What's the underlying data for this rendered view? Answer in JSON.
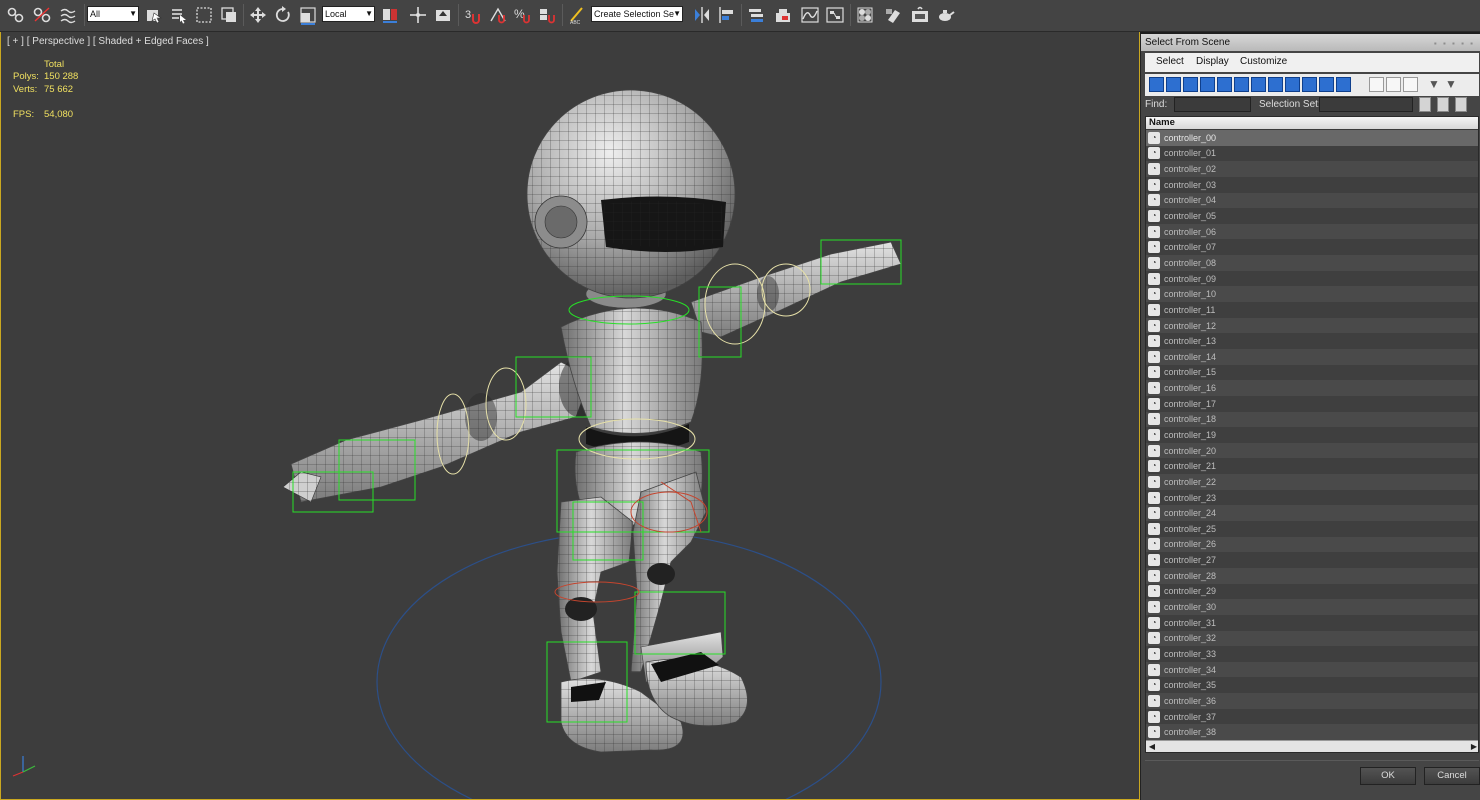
{
  "toolbar": {
    "filter_dropdown": "All",
    "coord_dropdown": "Local",
    "selection_set_dropdown": "Create Selection Se"
  },
  "viewport": {
    "label": "[ + ] [ Perspective ] [ Shaded + Edged Faces ]",
    "stats": {
      "header": "Total",
      "polys_label": "Polys:",
      "polys_value": "150 288",
      "verts_label": "Verts:",
      "verts_value": "75 662",
      "fps_label": "FPS:",
      "fps_value": "54,080"
    },
    "colors": {
      "background": "#3d3d3d",
      "border": "#caa820",
      "rig_green": "#27e027",
      "rig_yellow": "#e6e0a8",
      "ground_circle": "#2c4f88"
    }
  },
  "dialog": {
    "title": "Select From Scene",
    "menu": [
      "Select",
      "Display",
      "Customize"
    ],
    "find_label": "Find:",
    "selection_set_label": "Selection Set:",
    "column_header": "Name",
    "items": [
      "controller_00",
      "controller_01",
      "controller_02",
      "controller_03",
      "controller_04",
      "controller_05",
      "controller_06",
      "controller_07",
      "controller_08",
      "controller_09",
      "controller_10",
      "controller_11",
      "controller_12",
      "controller_13",
      "controller_14",
      "controller_15",
      "controller_16",
      "controller_17",
      "controller_18",
      "controller_19",
      "controller_20",
      "controller_21",
      "controller_22",
      "controller_23",
      "controller_24",
      "controller_25",
      "controller_26",
      "controller_27",
      "controller_28",
      "controller_29",
      "controller_30",
      "controller_31",
      "controller_32",
      "controller_33",
      "controller_34",
      "controller_35",
      "controller_36",
      "controller_37",
      "controller_38"
    ],
    "ok_label": "OK",
    "cancel_label": "Cancel"
  }
}
